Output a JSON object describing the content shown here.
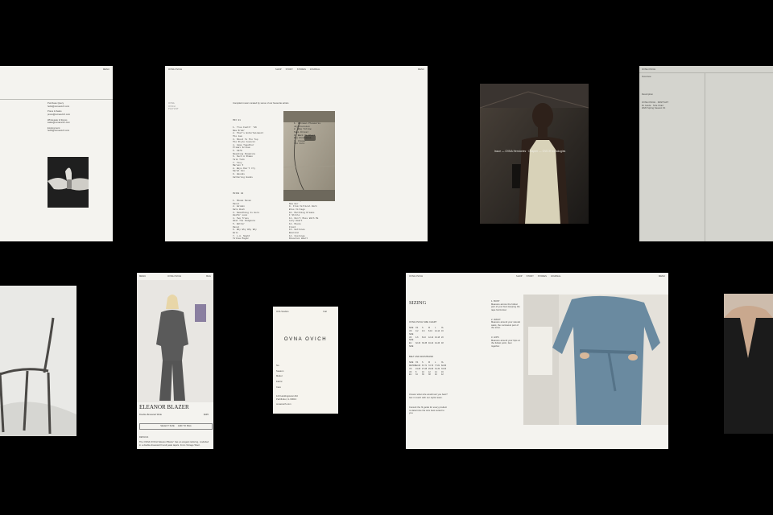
{
  "brand": {
    "name": "OVNA OVICH"
  },
  "card_contact": {
    "corner_label": "MENU",
    "blocks": [
      {
        "head": "Purchase Query",
        "body": "hello@ovnaovich.com"
      },
      {
        "head": "Press & Sales",
        "body": "press@ovnaovich.com"
      },
      {
        "head": "Wholesale & Stores",
        "body": "sales@ovnaovich.com"
      },
      {
        "head": "Employment",
        "body": "hello@ovnaovich.com"
      }
    ]
  },
  "card_playlist": {
    "logo": "OVNA OVICH",
    "nav": [
      "SHOP",
      "STORY",
      "STORES",
      "JOURNAL"
    ],
    "corner_label": "MENU",
    "side_label": [
      "OVNA",
      "OVICH",
      "PLAYLIST"
    ],
    "intro": "Compiled music curated by some of our favourite artists",
    "section_a": "MIX 01",
    "section_b": "OVICH 02",
    "tracks_left": [
      "1. True Faith' '86",
      "   New Order",
      "2. That's Entertainment",
      "   The Jam",
      "3. Shout To The Top",
      "   The Style Council",
      "4. Come Together",
      "   Primal Scream",
      "5. 1979",
      "   Smashing Pumpkins",
      "6. Such A Shame",
      "   Talk Talk",
      "7. Tiny",
      "   Maroon 5",
      "8. Boys Don't Cry",
      "   Sarah Fox",
      "9. Hounds",
      "   Fathering Hands"
    ],
    "tracks_bottom_left": [
      "1. Shoom Seven",
      "   Panel",
      "2. Golden",
      "   Kate Bush",
      "3. Something Is Here",
      "   Zeefer Loco",
      "4. Two Trees",
      "   Heal The Kidgeons",
      "5. Bitter",
      "   Panel",
      "6. Why Why Why Why",
      "   Eels",
      "7. L.A. Night",
      "   Yellow Magic"
    ],
    "tracks_bottom_right": [
      "8. New Age",
      "   New Her",
      "9. From Vertical Work",
      "   Blue Village",
      "10. Marching Dreams",
      "   I Stille",
      "11. Don't Mess With Me",
      "   Lazy Heart",
      "12. Moves",
      "   Fleet",
      "13. Hotlines",
      "   Emerald",
      "14. Feelings",
      "   Dissolve Heart"
    ],
    "tracks_right": [
      "1. Unknown Pleasures",
      "   Joy Division",
      "2. Big Yellow",
      "   Taxi Driver",
      "3. Back To Black",
      "   Amy Winehouse",
      "4. Closer",
      "   The Cure"
    ]
  },
  "card_editorial": {
    "caption": "Issue — OVNA Herstories · Chapter — OVICH Iconologies"
  },
  "card_panel": {
    "top_label": "OVNA OVICH",
    "left_text": [
      "Overview",
      "Description"
    ],
    "right_text": [
      "OVNA OVICH · PANTSUIT",
      "Fit Guide · Size Chart",
      "2020 Spring Season Fit"
    ]
  },
  "card_mobile": {
    "menu": "MENU",
    "logo": "OVNA OVICH",
    "bag": "BAG",
    "title": "ELEANOR BLAZER",
    "subtitle": "Double-Breasted Wide",
    "price": "$495",
    "size_button": "SELECT SIZE",
    "add_button": "ADD TO BAG",
    "section": "DETAILS",
    "description": "The OVNA OVICH 'Eleanor Blazer' has an elegant tailoring, modelled in a double-breasted fit and peak lapels. From Vintage Wool."
  },
  "card_tag": {
    "top_left": "OVA Studios",
    "top_right": "Fall",
    "logo": "OVNA OVICH",
    "lines": [
      "No.",
      "Season",
      "Model",
      "Fabric",
      "Care"
    ],
    "footer_a": "123 Hardingstown Rd",
    "footer_b": "Pathfinder, IL 60013",
    "footer_c": "ovnaovich.com"
  },
  "card_sizing": {
    "logo": "OVNA OVICH",
    "nav": [
      "SHOP",
      "STORY",
      "STORES",
      "JOURNAL"
    ],
    "corner_label": "MENU",
    "title": "SIZING",
    "chart_a_label": "OVNA OVICH SIZE CHART",
    "chart_a_header": [
      "SIZE",
      "XS",
      "S",
      "M",
      "L",
      "XL"
    ],
    "chart_a_rows": [
      [
        "US SIZE",
        "0-2",
        "4-6",
        "8-10",
        "12-14",
        "16"
      ],
      [
        "UK SIZE",
        "4-6",
        "8-10",
        "12-14",
        "16-18",
        "20"
      ],
      [
        "EU SIZE",
        "32-34",
        "36-38",
        "40-42",
        "44-46",
        "48"
      ]
    ],
    "chart_b_label": "BELT AND WAISTBAND",
    "chart_b_header": [
      "SIZE",
      "XS",
      "S",
      "M",
      "L",
      "XL"
    ],
    "chart_b_rows": [
      [
        "METRIC",
        "62-66",
        "67-71",
        "72-76",
        "77-81",
        "82-86"
      ],
      [
        "US",
        "24-26",
        "27-28",
        "29-30",
        "31-32",
        "33-34"
      ],
      [
        "UK",
        "8",
        "10",
        "12",
        "14",
        "16"
      ],
      [
        "EU",
        "34",
        "36",
        "38",
        "40",
        "42"
      ]
    ],
    "note_a": "Unsure what size would suit you best? Get in touch with our stylist team.",
    "note_b": "Consult the fit guide for every product to determine the size best suited to you.",
    "fit_notes": [
      {
        "head": "1. BUST",
        "body": "Measure across the fullest part of your bust keeping the tape horizontal."
      },
      {
        "head": "2. WAIST",
        "body": "Measure around your natural waist, the narrowest part of the torso."
      },
      {
        "head": "3. HIPS",
        "body": "Measure around your hips at the fullest point, feet together."
      }
    ]
  }
}
